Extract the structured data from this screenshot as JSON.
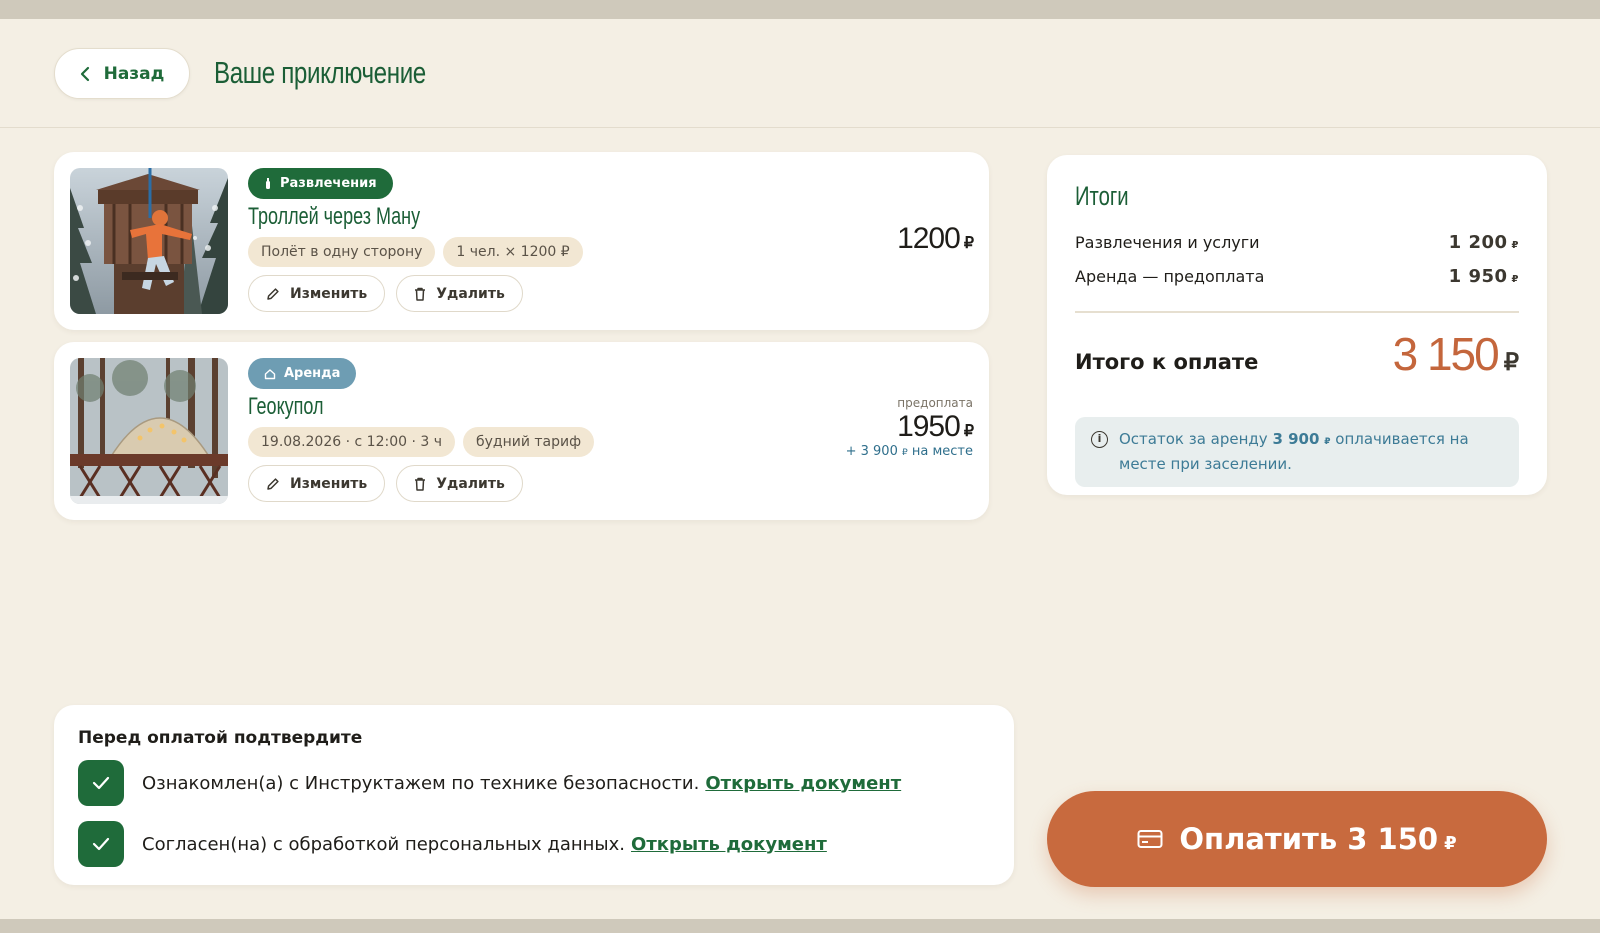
{
  "header": {
    "back_label": "Назад",
    "title": "Ваше приключение"
  },
  "items": [
    {
      "badge": "Развлечения",
      "title": "Троллей через Ману",
      "tags": [
        "Полёт в одну сторону",
        "1 чел. × 1200 ₽"
      ],
      "edit_label": "Изменить",
      "delete_label": "Удалить",
      "price": "1200",
      "currency": "₽"
    },
    {
      "badge": "Аренда",
      "title": "Геокупол",
      "tags": [
        "19.08.2026 · с 12:00 · 3 ч",
        "будний тариф"
      ],
      "edit_label": "Изменить",
      "delete_label": "Удалить",
      "price_caption": "предоплата",
      "price": "1950",
      "currency": "₽",
      "price_sub_prefix": "+ 3 900",
      "price_sub_suffix": "на месте"
    }
  ],
  "summary": {
    "title": "Итоги",
    "rows": [
      {
        "label": "Развлечения и услуги",
        "value": "1 200",
        "currency": "₽"
      },
      {
        "label": "Аренда — предоплата",
        "value": "1 950",
        "currency": "₽"
      }
    ],
    "total_label": "Итого к оплате",
    "total_value": "3 150",
    "total_currency": "₽",
    "note_prefix": "Остаток за аренду",
    "note_amount": "3 900",
    "note_currency": "₽",
    "note_suffix": "оплачивается на месте при заселении."
  },
  "confirm": {
    "title": "Перед оплатой подтвердите",
    "items": [
      {
        "text": "Ознакомлен(а) с Инструктажем по технике безопасности.",
        "link": "Открыть документ",
        "checked": true
      },
      {
        "text": "Согласен(на) с обработкой персональных данных.",
        "link": "Открыть документ",
        "checked": true
      }
    ]
  },
  "pay": {
    "label": "Оплатить 3 150",
    "currency": "₽"
  },
  "colors": {
    "brand_green": "#1f6b3a",
    "accent_orange": "#c86a3e",
    "rent_blue": "#6e9db3",
    "background": "#f4efe4"
  }
}
